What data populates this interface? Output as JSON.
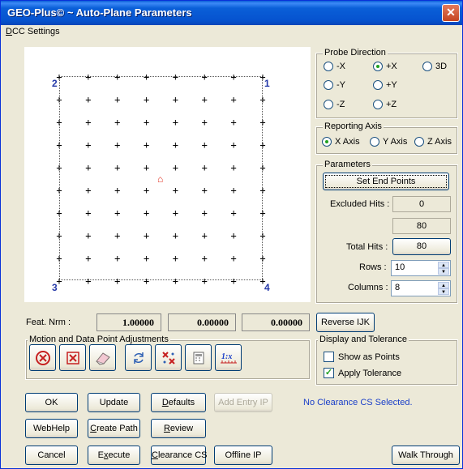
{
  "window": {
    "title": "GEO-Plus© ~ Auto-Plane Parameters",
    "close_glyph": "✕"
  },
  "menu": {
    "first_letter": "D",
    "rest": "CC Settings"
  },
  "plot": {
    "corners": [
      "2",
      "1",
      "3",
      "4"
    ]
  },
  "probe_direction": {
    "title": "Probe Direction",
    "options": [
      {
        "label": "-X",
        "selected": false
      },
      {
        "label": "+X",
        "selected": true
      },
      {
        "label": "3D",
        "selected": false
      },
      {
        "label": "-Y",
        "selected": false
      },
      {
        "label": "+Y",
        "selected": false
      },
      {
        "label": "-Z",
        "selected": false
      },
      {
        "label": "+Z",
        "selected": false
      }
    ]
  },
  "reporting_axis": {
    "title": "Reporting Axis",
    "options": [
      {
        "label": "X Axis",
        "selected": true
      },
      {
        "label": "Y Axis",
        "selected": false
      },
      {
        "label": "Z Axis",
        "selected": false
      }
    ]
  },
  "parameters": {
    "title": "Parameters",
    "set_end_points": "Set End Points",
    "excluded_hits_label": "Excluded Hits :",
    "excluded_hits_value": "0",
    "extra_value": "80",
    "total_hits_label": "Total Hits :",
    "total_hits_value": "80",
    "rows_label": "Rows :",
    "rows_value": "10",
    "columns_label": "Columns :",
    "columns_value": "8"
  },
  "feat_nrm": {
    "label": "Feat. Nrm :",
    "values": [
      "1.00000",
      "0.00000",
      "0.00000"
    ]
  },
  "reverse_ijk": "Reverse IJK",
  "motion": {
    "title": "Motion and Data Point Adjustments"
  },
  "display_tolerance": {
    "title": "Display and Tolerance",
    "show_as_points": {
      "label": "Show as Points",
      "checked": false
    },
    "apply_tolerance": {
      "label": "Apply Tolerance",
      "checked": true
    }
  },
  "buttons": {
    "ok": "OK",
    "update": "Update",
    "defaults_u": "D",
    "defaults_rest": "efaults",
    "add_entry_ip": "Add Entry IP",
    "webhelp": "WebHelp",
    "create_path_u": "C",
    "create_path_rest": "reate Path",
    "review_u": "R",
    "review_rest": "eview",
    "cancel": "Cancel",
    "execute_pre": "E",
    "execute_u": "x",
    "execute_rest": "ecute",
    "clearance_u": "C",
    "clearance_rest": "learance CS",
    "offline_ip": "Offline IP",
    "walk_through": "Walk Through"
  },
  "status": "No Clearance CS Selected."
}
